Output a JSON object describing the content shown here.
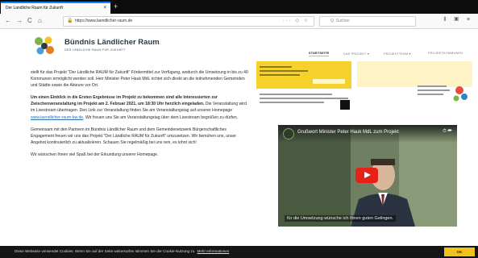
{
  "browser": {
    "tab_title": "Der Landliche Raum für Zukunft",
    "tab_close": "×",
    "new_tab": "+",
    "url": "https://www.laendlicher-raum.de",
    "search_placeholder": "Q. Suchen",
    "nav": {
      "back": "←",
      "forward": "→",
      "reload": "C",
      "home": "⌂"
    },
    "url_actions": "··· ◇ ☆",
    "toolbar_icons": "⫴ ▣ ≡"
  },
  "site": {
    "brand": "Bündnis Ländlicher Raum",
    "brand_sub": "DER LÄNDLICHE RAUM FÜR ZUKUNFT",
    "menu": [
      {
        "label": "STARTSEITE",
        "active": true
      },
      {
        "label": "DAS PROJEKT ▾",
        "active": false
      },
      {
        "label": "PROJEKTTEAM ▾",
        "active": false
      },
      {
        "label": "PROJEKTKOMMUNEN",
        "active": false
      }
    ]
  },
  "article": {
    "p1": "stellt für das Projekt \"Der Ländliche RAUM für Zukunft\" Fördermittel zur Verfügung, wodurch die Umsetzung in bis zu 40 Kommunen ermöglicht werden soll. Herr Minister Peter Hauk MdL richtet sich direkt an die teilnehmenden Gemeinden und Städte sowie die Akteure vor Ort.",
    "p2_bold": "Um einen Einblick in die Ersten Ergebnisse im Projekt zu bekommen sind alle Interessierten zur Zwischenveranstaltung im Projekt am 2. Februar 2021, um 18:30 Uhr herzlich eingeladen.",
    "p2_rest": " Die Veranstaltung wird im Livestream übertragen. Den Link zur Veranstaltung finden Sie am Veranstaltungstag auf unserer Homepage",
    "p2_link": "www.laendlicher-raum-bw.de",
    "p2_end": ". Wir freuen uns Sie am Veranstaltungstag über dem Livestream begrüßen zu dürfen.",
    "p3": "Gemeinsam mit den Partnern im Bündnis Ländlicher Raum und dem Gemeindenetzwerk Bürgerschaftliches Engagement freuen wir uns das Projekt \"Der Ländliche RAUM für Zukunft\" umzusetzen. Wir bemühen uns, unser Angebot kontinuierlich zu aktualisieren. Schauen Sie regelmäßig bei uns rein, es lohnt sich!",
    "p4": "Wir wünschen Ihnen viel Spaß bei der Erkundung unserer Homepage."
  },
  "video": {
    "title": "Grußwort Minister Peter Hauk MdL zum Projekt",
    "caption": "für die Umsetzung wünsche ich Ihnen guten Gelingen.",
    "top_icons": "⏱ ➦"
  },
  "cookie": {
    "text": "Diese Webseite verwendet Cookies. Wenn Sie auf der Seite weitersurfen stimmen Sie der Cookie-Nutzung zu.",
    "link": "Mehr Informationen",
    "ok": "OK"
  },
  "colors": {
    "accent": "#f3c11c",
    "tab_accent": "#0a84ff",
    "link": "#2a6db0",
    "brand_text": "#2e3a42"
  }
}
